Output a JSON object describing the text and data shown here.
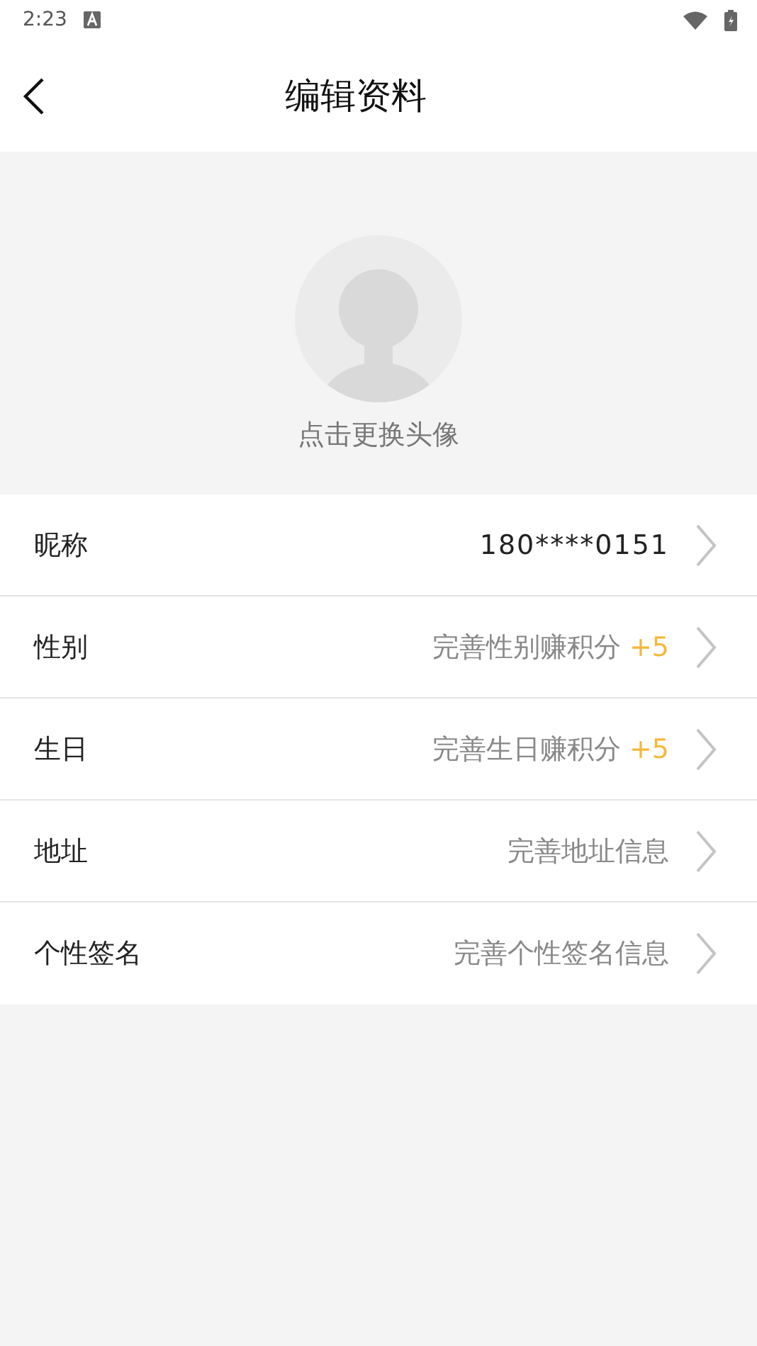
{
  "status_bar": {
    "time": "2:23"
  },
  "header": {
    "title": "编辑资料"
  },
  "avatar": {
    "caption": "点击更换头像"
  },
  "rows": [
    {
      "label": "昵称",
      "value": "180****0151",
      "filled": true
    },
    {
      "label": "性别",
      "value": "完善性别赚积分",
      "bonus": "+5",
      "filled": false
    },
    {
      "label": "生日",
      "value": "完善生日赚积分",
      "bonus": "+5",
      "filled": false
    },
    {
      "label": "地址",
      "value": "完善地址信息",
      "filled": false
    },
    {
      "label": "个性签名",
      "value": "完善个性签名信息",
      "filled": false
    }
  ]
}
